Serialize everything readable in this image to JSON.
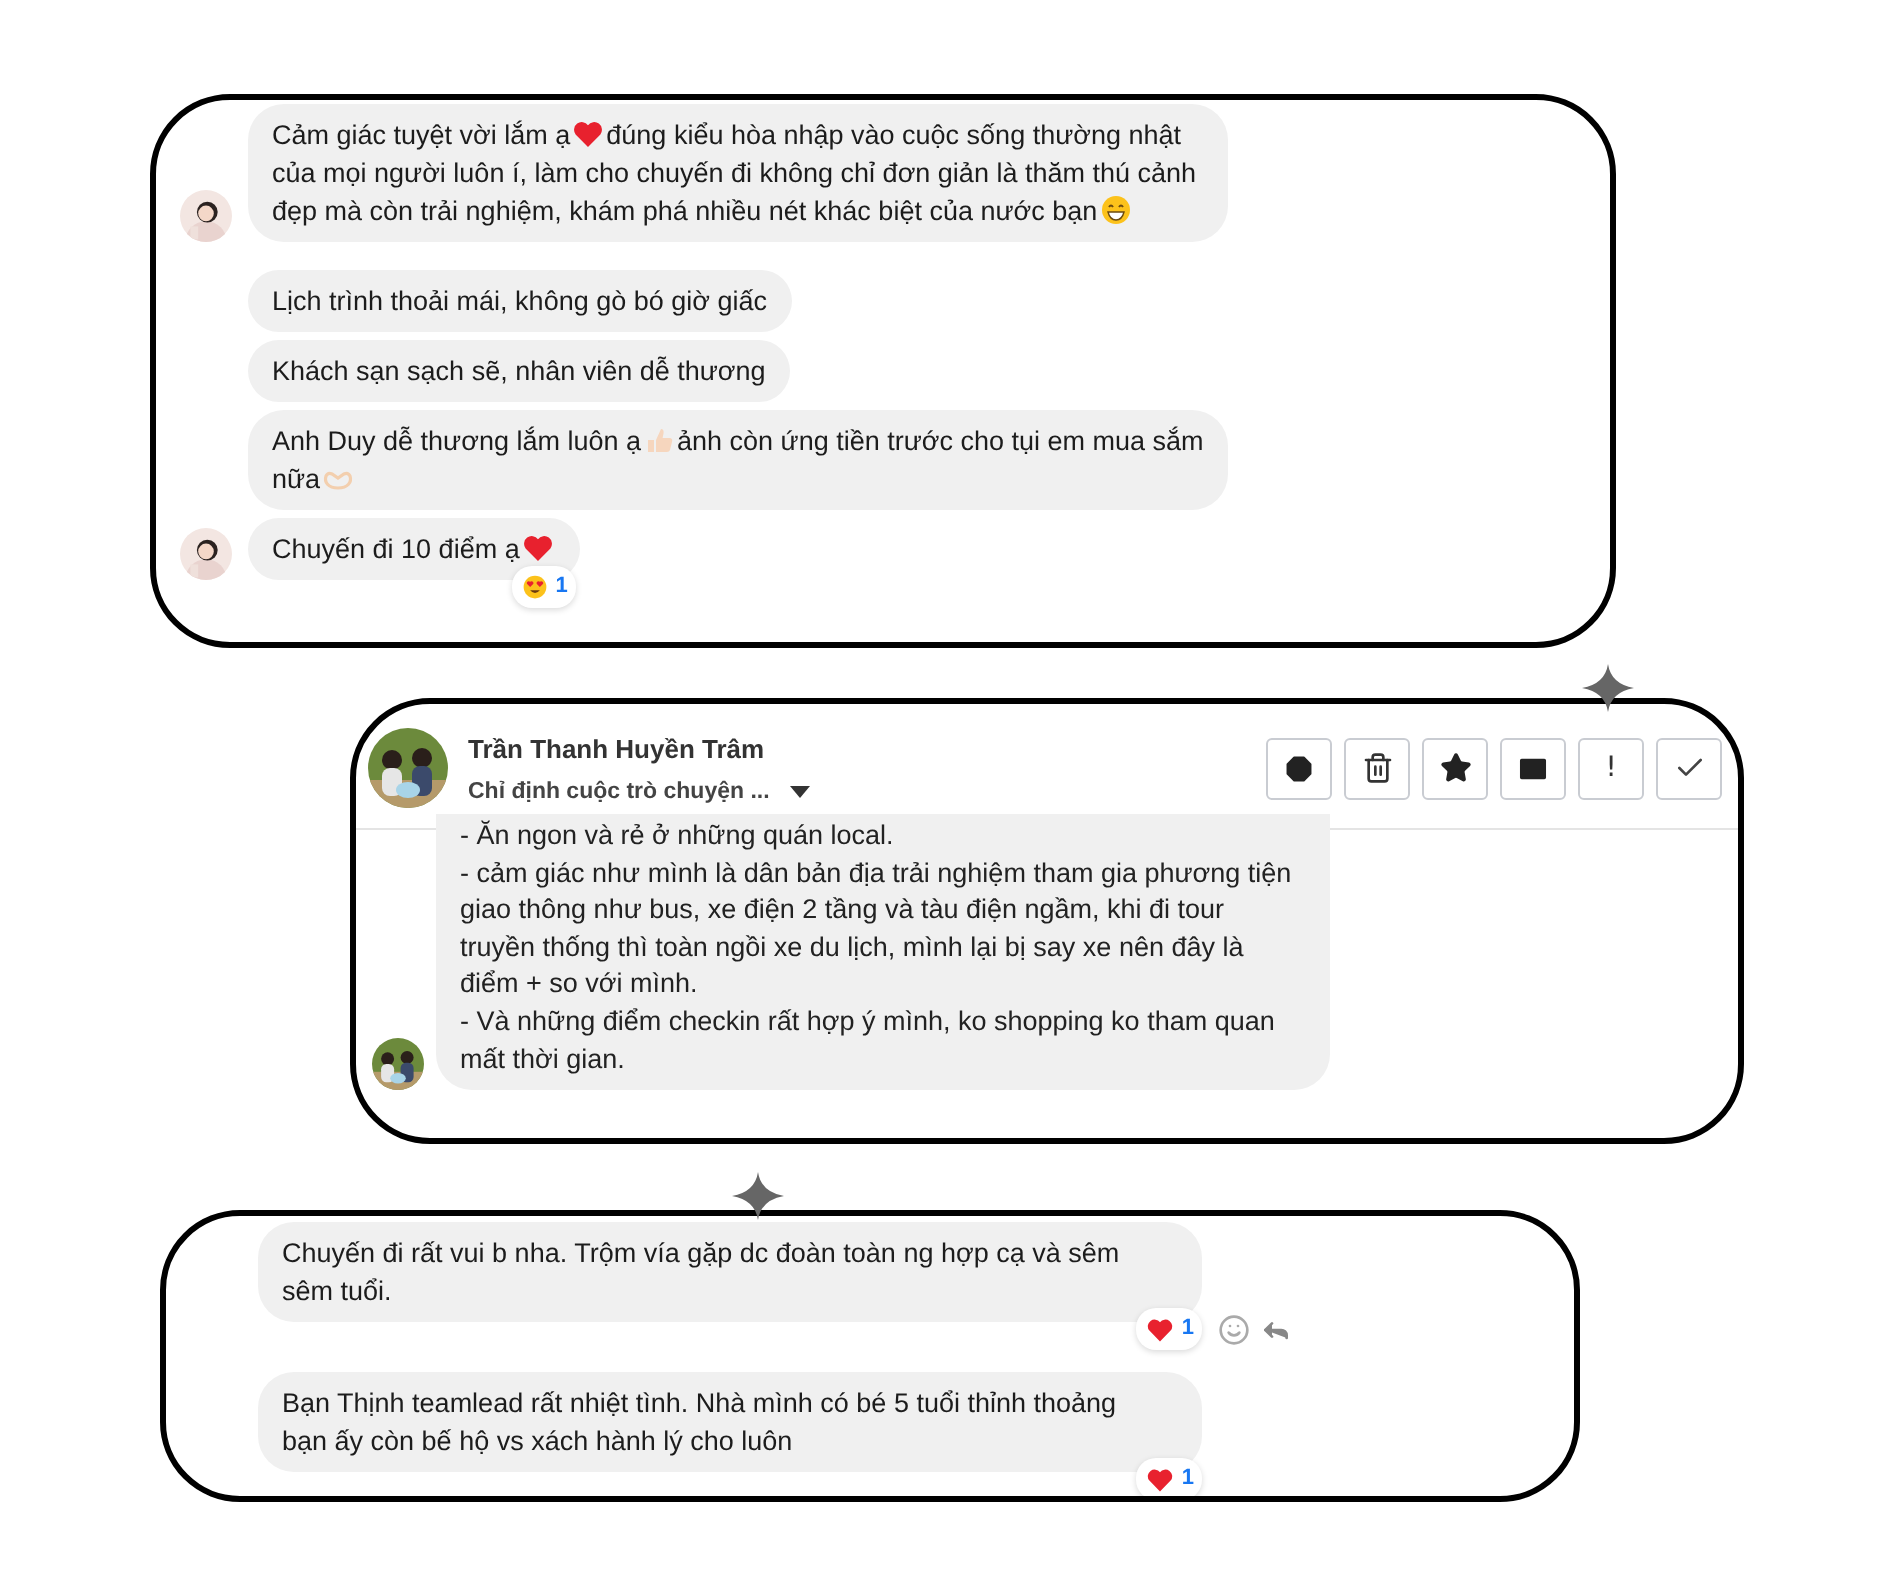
{
  "chat_top": {
    "groups": [
      {
        "avatar": {
          "kind": "picture"
        },
        "messages": [
          {
            "parts": [
              {
                "kind": "text",
                "text": "Cảm giác tuyệt vời lắm ạ"
              },
              {
                "kind": "emoji"
              },
              {
                "kind": "text",
                "text": "đúng kiểu hòa nhập vào cuộc sống thường nhật của mọi người luôn í, làm cho chuyến đi không chỉ đơn giản là thăm thú cảnh đẹp mà còn trải nghiệm, khám phá nhiều nét khác biệt của nước bạn"
              },
              {
                "kind": "emoji"
              }
            ]
          }
        ]
      },
      {
        "avatar": {
          "kind": "picture"
        },
        "messages": [
          {
            "parts": [
              {
                "kind": "text",
                "text": "Lịch trình thoải mái, không gò bó giờ giấc"
              }
            ]
          },
          {
            "parts": [
              {
                "kind": "text",
                "text": "Khách sạn sạch sẽ, nhân viên dễ thương"
              }
            ]
          },
          {
            "parts": [
              {
                "kind": "text",
                "text": "Anh Duy dễ thương lắm luôn ạ"
              },
              {
                "kind": "emoji"
              },
              {
                "kind": "text",
                "text": "ảnh còn ứng tiền trước cho tụi em mua sắm nữa"
              },
              {
                "kind": "emoji"
              }
            ]
          },
          {
            "parts": [
              {
                "kind": "text",
                "text": "Chuyến đi 10 điểm ạ"
              },
              {
                "kind": "emoji"
              }
            ],
            "reaction": {
              "count": "1"
            }
          }
        ]
      }
    ]
  },
  "conversation_window": {
    "contact_name": "Trần Thanh Huyền Trâm",
    "subtitle": "Chỉ định cuộc trò chuyện ...",
    "actions": [
      {
        "kind": "icon"
      },
      {
        "kind": "icon"
      },
      {
        "kind": "icon"
      },
      {
        "kind": "icon"
      },
      {
        "kind": "text",
        "label": "!"
      },
      {
        "kind": "icon"
      }
    ],
    "message": {
      "lines": [
        "- Ăn ngon và rẻ ở những quán local.",
        "- cảm giác như mình là dân bản địa trải nghiệm tham gia phương tiện giao thông như bus, xe điện 2 tầng và tàu điện ngầm, khi đi tour truyền thống thì toàn ngồi xe du lịch, mình lại bị say xe nên đây là điểm + so với mình.",
        "- Và những điểm checkin rất hợp ý mình, ko shopping ko tham quan mất thời gian."
      ]
    }
  },
  "chat_bottom": {
    "messages": [
      {
        "text": "Chuyến đi rất vui b nha. Trộm vía gặp dc đoàn toàn ng hợp cạ và sêm sêm tuổi.",
        "reaction": {
          "count": "1"
        },
        "actions_visible": true
      },
      {
        "text": "Bạn Thịnh teamlead rất nhiệt tình. Nhà mình có bé 5 tuổi thỉnh thoảng bạn ấy còn bế hộ vs xách hành lý cho luôn",
        "reaction": {
          "count": "1"
        },
        "actions_visible": false
      }
    ]
  }
}
